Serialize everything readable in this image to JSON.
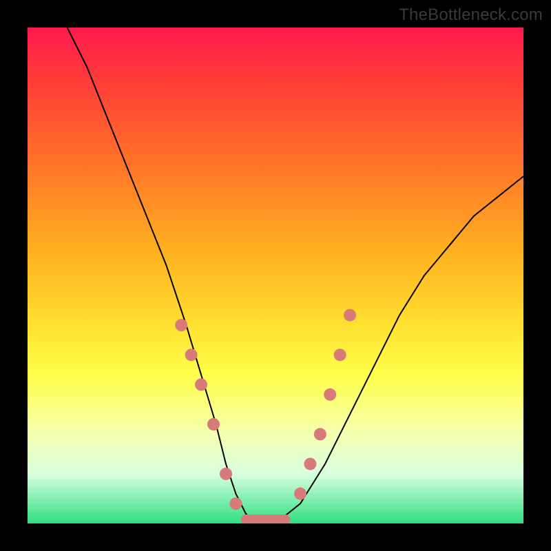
{
  "watermark": "TheBottleneck.com",
  "chart_data": {
    "type": "line",
    "title": "",
    "xlabel": "",
    "ylabel": "",
    "xlim": [
      0,
      100
    ],
    "ylim": [
      0,
      100
    ],
    "series": [
      {
        "name": "bottleneck-curve",
        "x": [
          8,
          12,
          16,
          20,
          24,
          28,
          32,
          35,
          38,
          40,
          42,
          44,
          46,
          50,
          55,
          60,
          65,
          70,
          75,
          80,
          85,
          90,
          95,
          100
        ],
        "y": [
          100,
          92,
          82,
          72,
          62,
          52,
          40,
          30,
          20,
          12,
          6,
          2,
          0,
          0,
          4,
          12,
          22,
          32,
          42,
          50,
          56,
          62,
          66,
          70
        ]
      }
    ],
    "markers": {
      "name": "highlight-dots",
      "x": [
        31,
        33,
        35,
        37.5,
        40,
        42,
        55,
        57,
        59,
        61,
        63,
        65
      ],
      "y": [
        40,
        34,
        28,
        20,
        10,
        4,
        6,
        12,
        18,
        26,
        34,
        42
      ]
    },
    "flat_bottom": {
      "x0": 44,
      "x1": 52,
      "y": 0
    }
  }
}
